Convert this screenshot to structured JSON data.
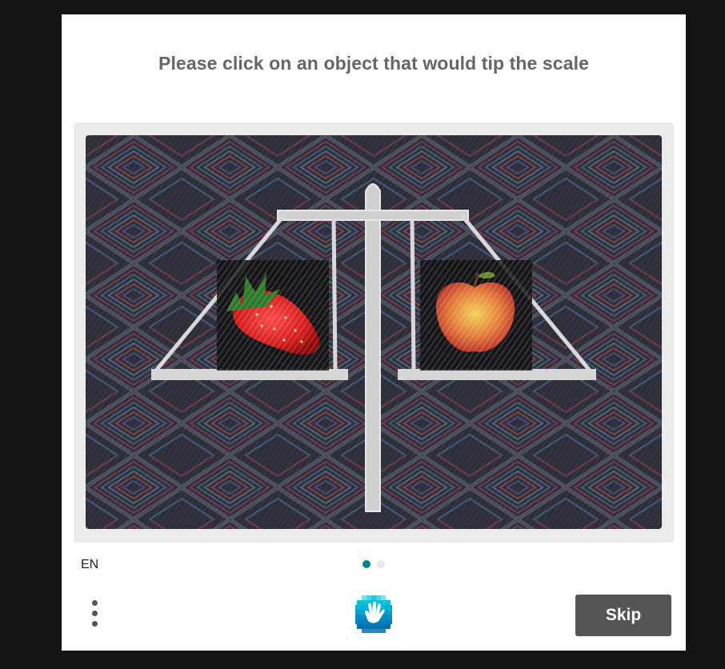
{
  "challenge": {
    "prompt": "Please click on an object that would tip the scale",
    "objects": [
      {
        "name": "strawberry"
      },
      {
        "name": "apple"
      }
    ]
  },
  "footer": {
    "language": "EN",
    "skip_label": "Skip",
    "menu_icon": "more-vertical-icon",
    "logo_icon": "hcaptcha-hand-logo"
  },
  "pagination": {
    "current": 1,
    "total": 2
  },
  "colors": {
    "accent": "#00838f",
    "button": "#555555",
    "prompt_text": "#666666",
    "dot_inactive": "#e8e8e8"
  }
}
